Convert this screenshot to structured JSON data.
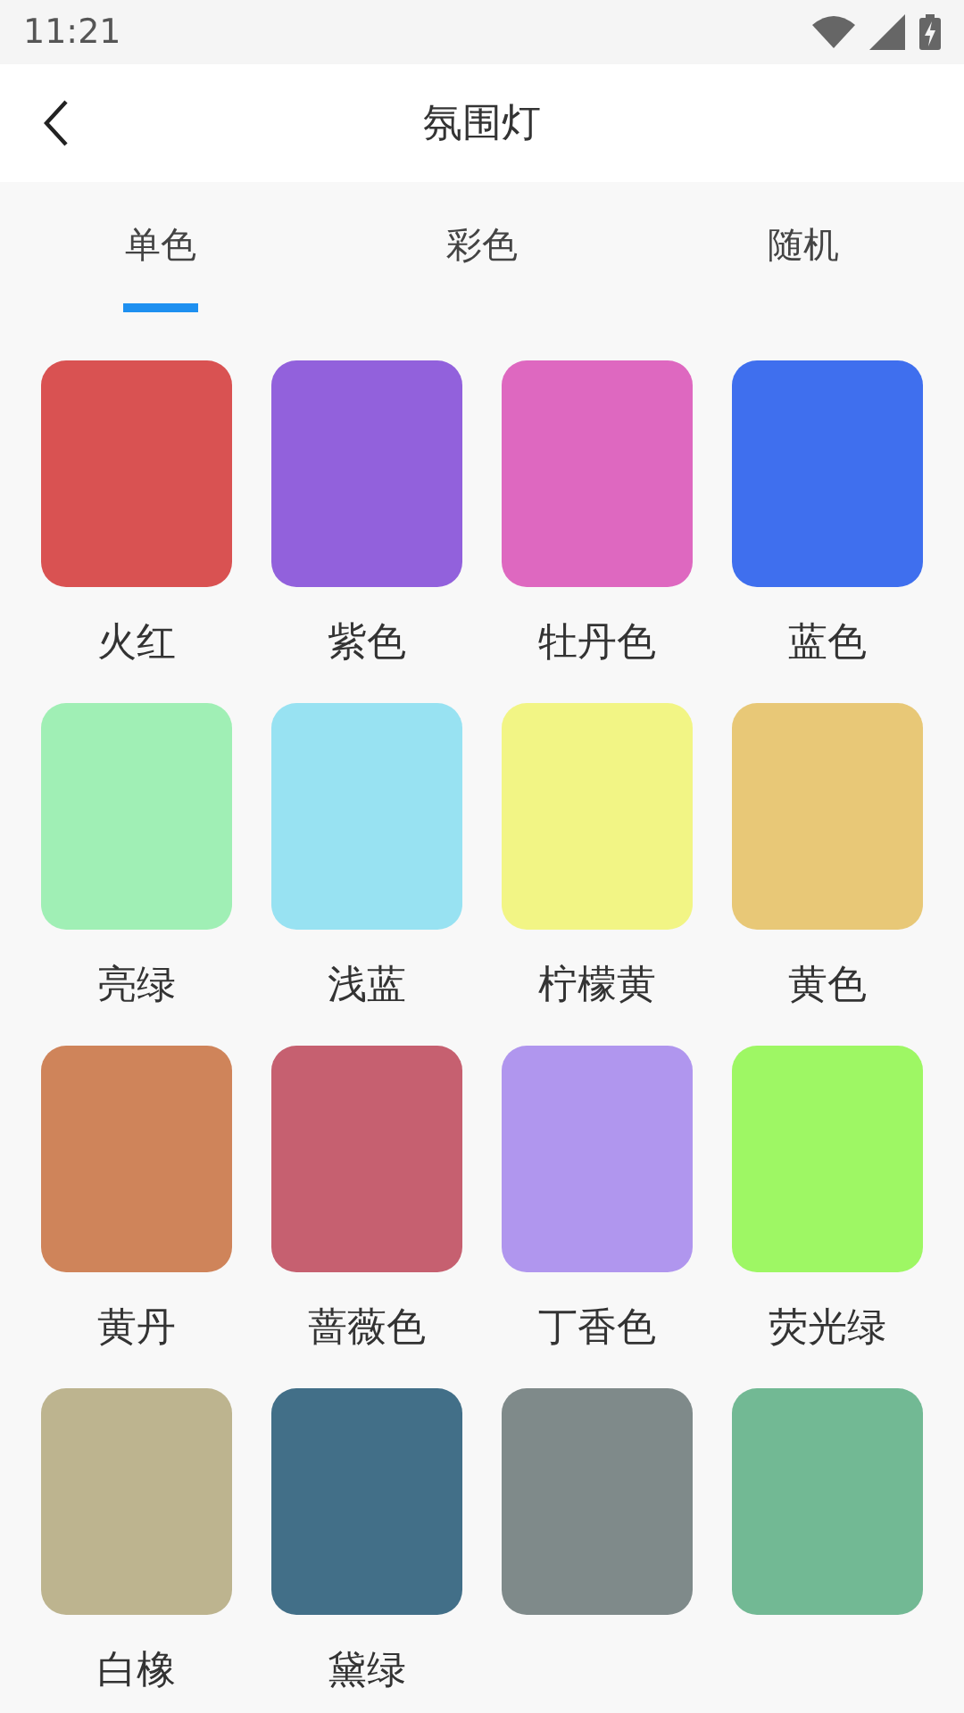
{
  "status_bar": {
    "time": "11:21"
  },
  "header": {
    "title": "氛围灯"
  },
  "tabs": [
    {
      "label": "单色",
      "selected": true
    },
    {
      "label": "彩色",
      "selected": false
    },
    {
      "label": "随机",
      "selected": false
    }
  ],
  "colors": [
    {
      "label": "火红",
      "color": "#d95252"
    },
    {
      "label": "紫色",
      "color": "#9261dc"
    },
    {
      "label": "牡丹色",
      "color": "#de68c0"
    },
    {
      "label": "蓝色",
      "color": "#3f6fee"
    },
    {
      "label": "亮绿",
      "color": "#a0efb5"
    },
    {
      "label": "浅蓝",
      "color": "#98e2f2"
    },
    {
      "label": "柠檬黄",
      "color": "#f2f585"
    },
    {
      "label": "黄色",
      "color": "#e8c877"
    },
    {
      "label": "黄丹",
      "color": "#cf845a"
    },
    {
      "label": "蔷薇色",
      "color": "#c66070"
    },
    {
      "label": "丁香色",
      "color": "#b096ee"
    },
    {
      "label": "荧光绿",
      "color": "#9ef764"
    },
    {
      "label": "白橡",
      "color": "#bdb48f"
    },
    {
      "label": "黛绿",
      "color": "#426f88"
    },
    {
      "color": "#7f8a8a"
    },
    {
      "color": "#72b994"
    }
  ]
}
